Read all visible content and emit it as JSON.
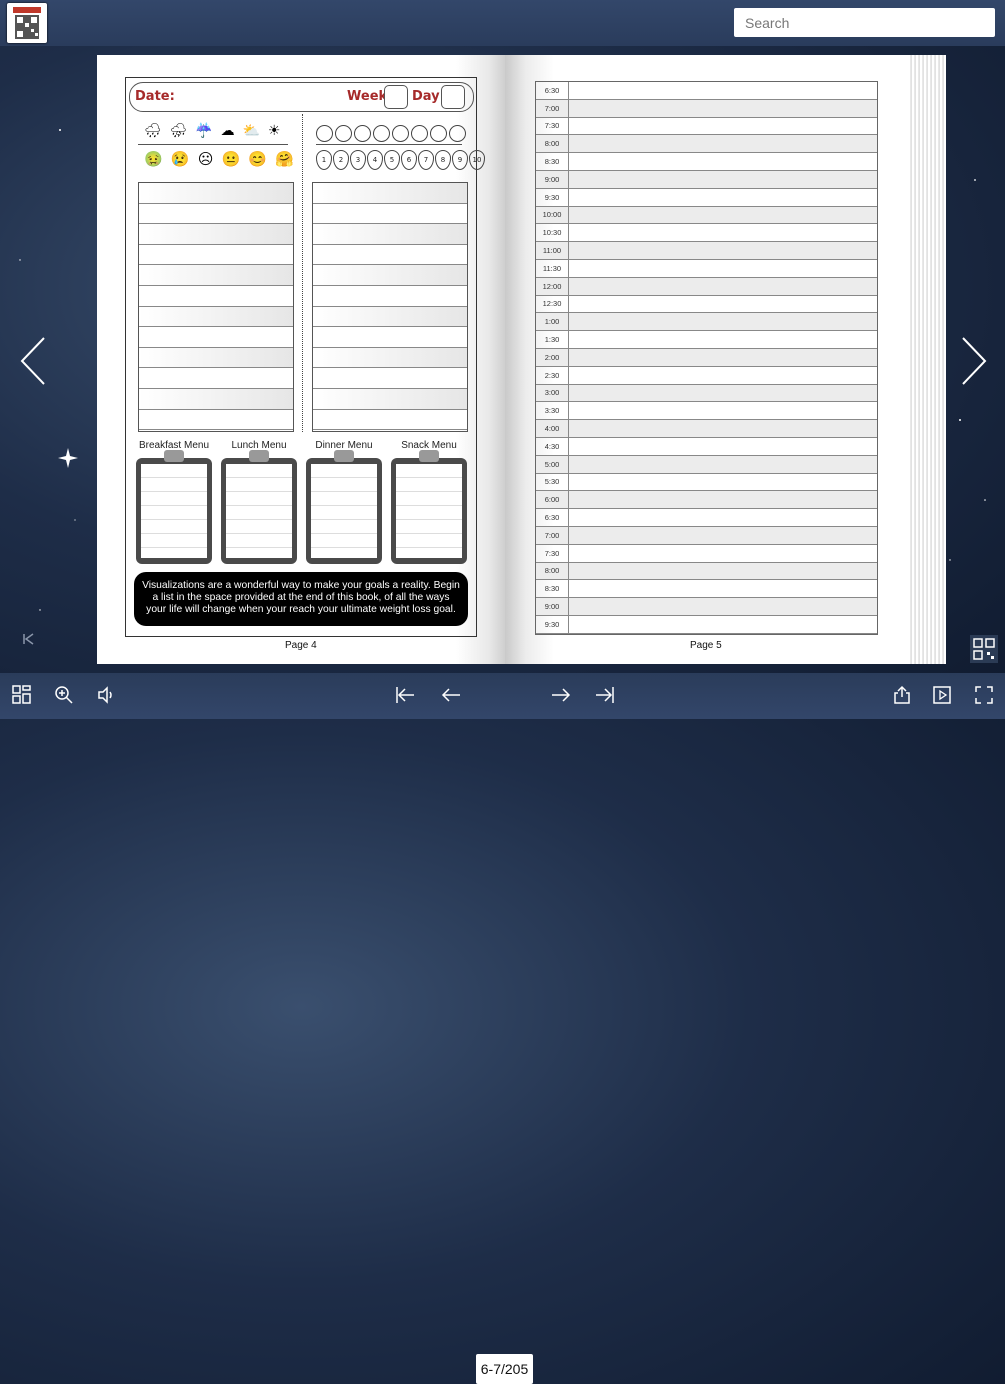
{
  "header": {
    "search_placeholder": "Search"
  },
  "left_page": {
    "date_label": "Date:",
    "week_label": "Week",
    "day_label": "Day",
    "weather_icons": "🌧 ⛈ ☔ ☁ ⛅ ☀",
    "mood_icons": "🤢 😢 ☹ 😐 😊 🤗",
    "drops": [
      "1",
      "2",
      "3",
      "4",
      "5",
      "6",
      "7",
      "8",
      "9",
      "10"
    ],
    "menus": [
      "Breakfast Menu",
      "Lunch Menu",
      "Dinner Menu",
      "Snack Menu"
    ],
    "banner": "Visualizations are a wonderful way to make your goals a reality. Begin a list in the space provided at the end of this book, of all the ways your life will change when your reach your ultimate weight loss goal.",
    "page_label": "Page 4"
  },
  "right_page": {
    "times": [
      "6:30",
      "7:00",
      "7:30",
      "8:00",
      "8:30",
      "9:00",
      "9:30",
      "10:00",
      "10:30",
      "11:00",
      "11:30",
      "12:00",
      "12:30",
      "1:00",
      "1:30",
      "2:00",
      "2:30",
      "3:00",
      "3:30",
      "4:00",
      "4:30",
      "5:00",
      "5:30",
      "6:00",
      "6:30",
      "7:00",
      "7:30",
      "8:00",
      "8:30",
      "9:00",
      "9:30"
    ],
    "page_label": "Page 5"
  },
  "toolbar": {
    "page_indicator": "6-7/205"
  },
  "icons": {
    "thumbnails": "thumbnails-icon",
    "zoom": "zoom-in-icon",
    "sound": "sound-icon",
    "first": "first-page-icon",
    "prev": "prev-page-icon",
    "next": "next-page-icon",
    "last": "last-page-icon",
    "share": "share-icon",
    "autoplay": "autoplay-icon",
    "fullscreen": "fullscreen-icon",
    "qr": "qr-code-icon"
  }
}
